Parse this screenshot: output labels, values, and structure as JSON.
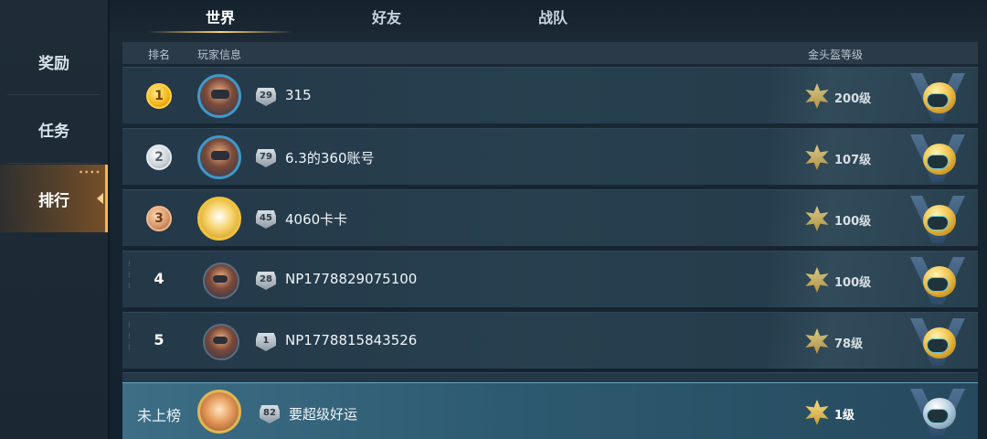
{
  "sidebar": {
    "items": [
      {
        "label": "奖励"
      },
      {
        "label": "任务"
      },
      {
        "label": "排行"
      }
    ],
    "dots": "••••"
  },
  "tabs": [
    {
      "label": "世界"
    },
    {
      "label": "好友"
    },
    {
      "label": "战队"
    }
  ],
  "header": {
    "rank": "排名",
    "info": "玩家信息",
    "level": "金头盔等级"
  },
  "rows": [
    {
      "rank": "1",
      "level_badge": "29",
      "name": "315",
      "helmet_level": "200级"
    },
    {
      "rank": "2",
      "level_badge": "79",
      "name": "6.3的360账号",
      "helmet_level": "107级"
    },
    {
      "rank": "3",
      "level_badge": "45",
      "name": "4060卡卡",
      "helmet_level": "100级"
    },
    {
      "rank": "4",
      "level_badge": "28",
      "name": "NP1778829075100",
      "helmet_level": "100级"
    },
    {
      "rank": "5",
      "level_badge": "1",
      "name": "NP1778815843526",
      "helmet_level": "78级"
    }
  ],
  "my_row": {
    "rank_label": "未上榜",
    "level_badge": "82",
    "name": "要超级好运",
    "helmet_level": "1级"
  },
  "icons": {
    "rank_medals": [
      "gold-medal-icon",
      "silver-medal-icon",
      "bronze-medal-icon"
    ],
    "level": "star-icon",
    "badge": "winged-helmet-icon"
  }
}
